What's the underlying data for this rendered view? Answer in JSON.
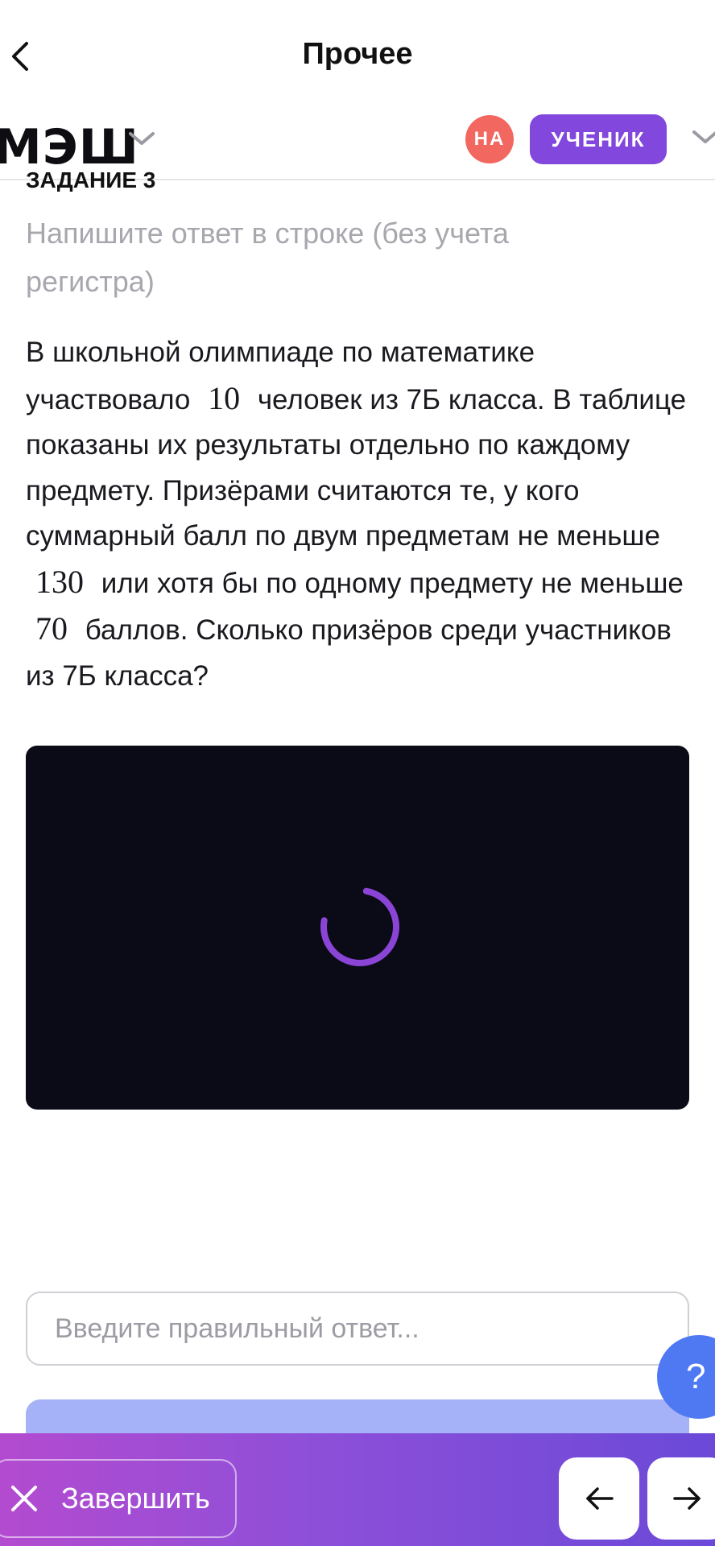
{
  "topbar": {
    "title": "Прочее",
    "back_icon": "chevron-left-icon"
  },
  "appbar": {
    "logo": "МЭШ",
    "avatar_initials": "НА",
    "role_label": "УЧЕНИК"
  },
  "task": {
    "label": "ЗАДАНИЕ 3",
    "hint": "Напишите ответ в строке (без учета регистра)",
    "question": {
      "part1": "В школьной олимпиаде по математике участвовало",
      "num1": "10",
      "part2": "человек из 7Б класса. В таблице показаны их результаты отдельно по каждому предмету. Призёрами считаются те, у кого суммарный балл по двум предметам не меньше",
      "num2": "130",
      "part3": "или хотя бы по одному предмету не меньше",
      "num3": "70",
      "part4": "баллов. Сколько призёров среди участников из 7Б класса?"
    }
  },
  "answer": {
    "placeholder": "Введите правильный ответ..."
  },
  "help": {
    "label": "?"
  },
  "bottom": {
    "finish_label": "Завершить"
  },
  "colors": {
    "accent": "#8247dd",
    "avatar": "#f2675f",
    "help": "#4f79f3",
    "submit": "#a5b2f7",
    "media_bg": "#0b0a17"
  }
}
